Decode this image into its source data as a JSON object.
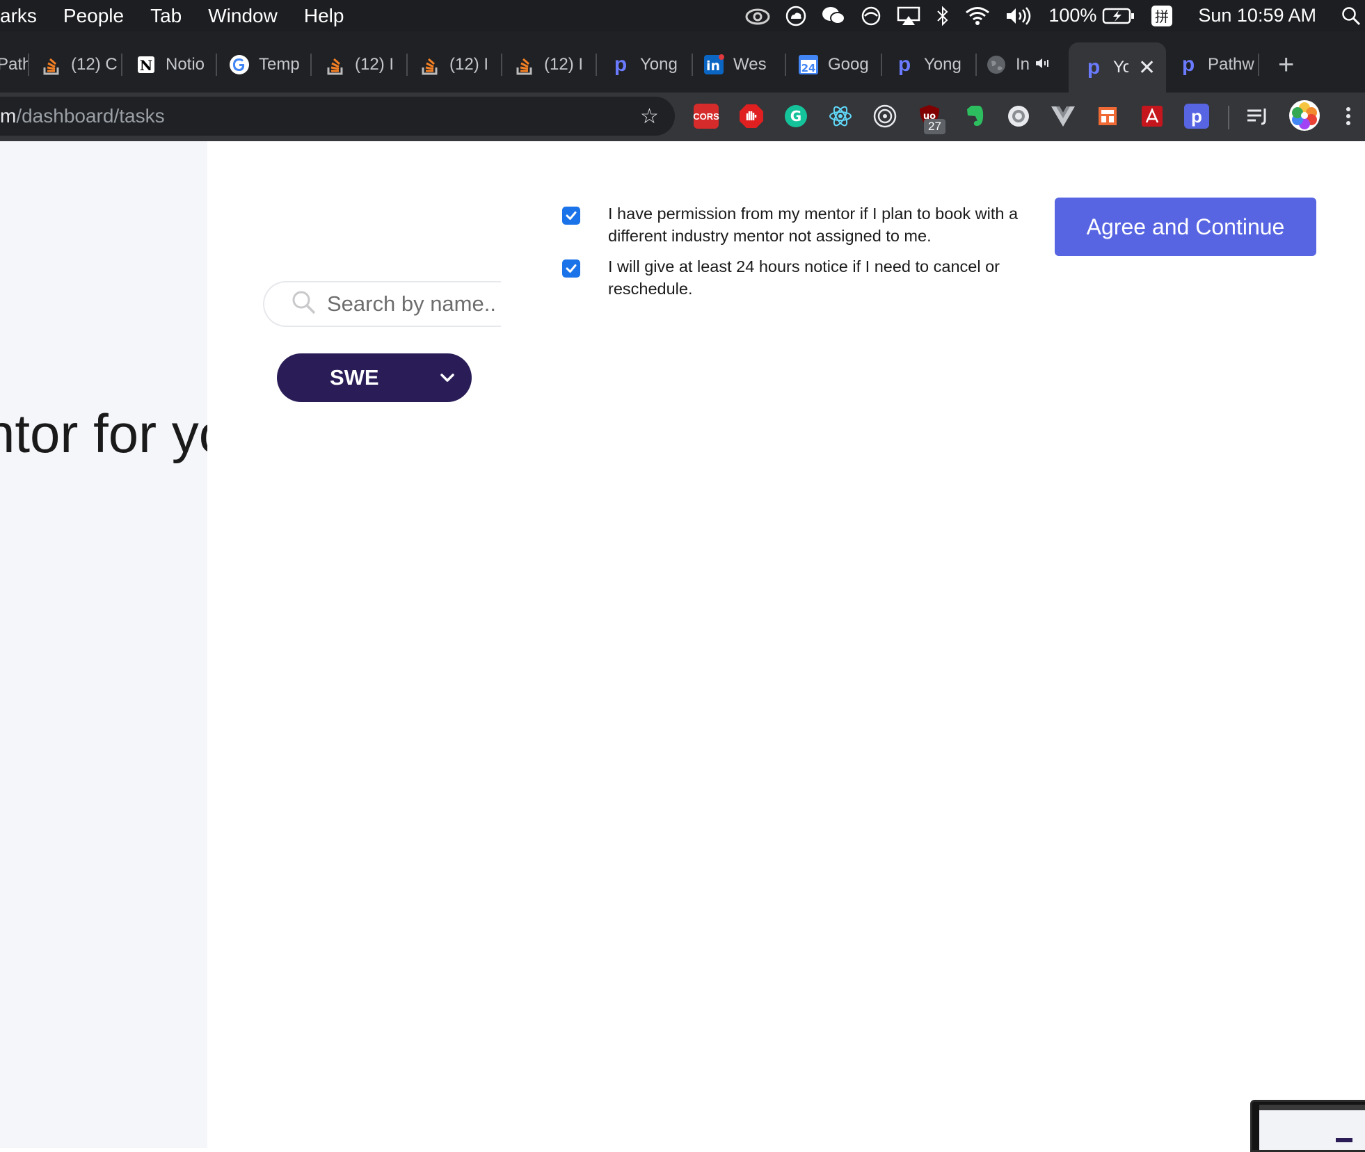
{
  "menubar": {
    "items": [
      "arks",
      "People",
      "Tab",
      "Window",
      "Help"
    ],
    "battery": "100%",
    "clock": "Sun 10:59 AM",
    "icons": [
      "creative-cloud-icon",
      "cloud-icon",
      "wechat-icon",
      "sync-icon",
      "airplay-icon",
      "bluetooth-icon",
      "wifi-icon",
      "volume-icon",
      "battery-icon",
      "input-method-icon",
      "spotlight-icon"
    ]
  },
  "tabs": [
    {
      "label": "Path",
      "icon": "pathways-icon"
    },
    {
      "label": "(12) C",
      "icon": "stackoverflow-icon"
    },
    {
      "label": "Notio",
      "icon": "notion-icon"
    },
    {
      "label": "Temp",
      "icon": "google-icon"
    },
    {
      "label": "(12) I",
      "icon": "stackoverflow-icon"
    },
    {
      "label": "(12) I",
      "icon": "stackoverflow-icon"
    },
    {
      "label": "(12) I",
      "icon": "stackoverflow-icon"
    },
    {
      "label": "Yong",
      "icon": "pathways-icon"
    },
    {
      "label": "Wes",
      "icon": "linkedin-icon"
    },
    {
      "label": "Goog",
      "icon": "calendar-icon",
      "calendar_day": "24"
    },
    {
      "label": "Yong",
      "icon": "pathways-icon"
    },
    {
      "label": "In",
      "icon": "globe-icon"
    },
    {
      "label": "Yo",
      "icon": "pathways-icon",
      "active": true
    },
    {
      "label": "Pathw",
      "icon": "pathways-icon"
    }
  ],
  "address_bar": {
    "url_host_tail": "m",
    "url_path": "/dashboard/tasks"
  },
  "extensions": {
    "cors_label": "CORS",
    "ublock_badge": "27",
    "pathways_letter": "p",
    "items": [
      "cors-icon",
      "adblock-icon",
      "grammarly-icon",
      "react-devtools-icon",
      "target-icon",
      "ublock-icon",
      "evernote-icon",
      "camera-icon",
      "vue-devtools-icon",
      "layout-icon",
      "acrobat-icon",
      "pathways-ext-icon",
      "reading-list-icon",
      "profile-avatar-icon",
      "more-menu-icon"
    ]
  },
  "page": {
    "hero_text": "ntor for yo",
    "search": {
      "placeholder": "Search by name.."
    },
    "filter": {
      "selected": "SWE"
    },
    "agreements": [
      {
        "text": "I have permission from my mentor if I plan to book with a different industry mentor not assigned to me.",
        "checked": true
      },
      {
        "text": "I will give at least 24 hours notice if I need to cancel or reschedule.",
        "checked": true
      }
    ],
    "agree_button": "Agree and Continue"
  },
  "colors": {
    "accent": "#5865e3",
    "filter_bg": "#2a1d57",
    "checkbox": "#1a73e8",
    "left_panel": "#f5f6fa"
  }
}
